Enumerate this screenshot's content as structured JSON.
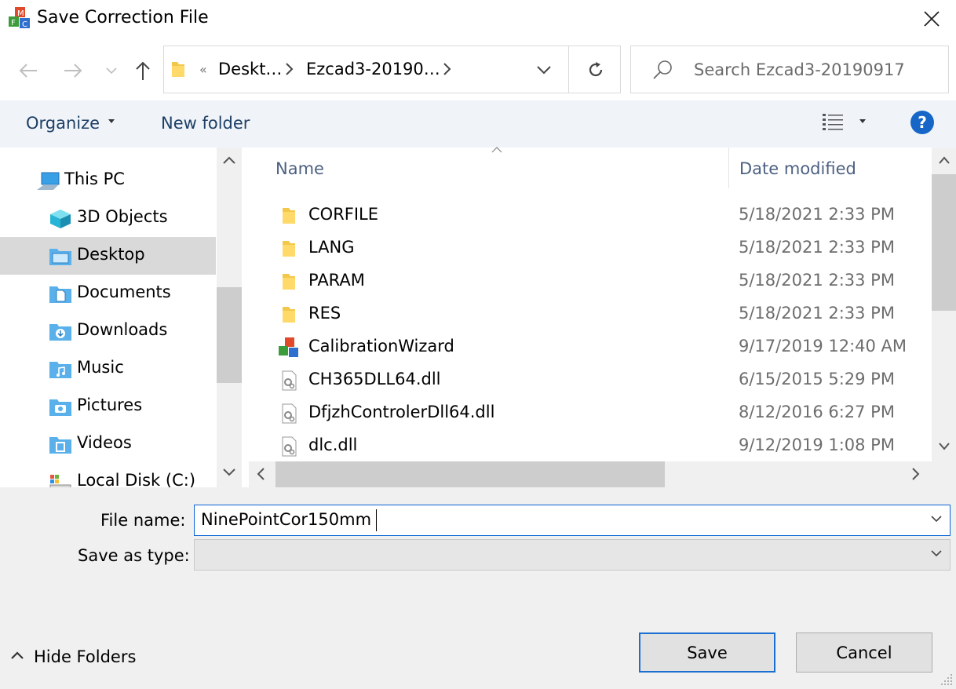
{
  "window": {
    "title": "Save Correction File",
    "app_icon": "mcc-cube-icon",
    "close_icon": "close-icon"
  },
  "nav": {
    "back_icon": "arrow-left-icon",
    "forward_icon": "arrow-right-icon",
    "recent_icon": "chevron-down-icon",
    "up_icon": "arrow-up-icon",
    "breadcrumb_overflow": "«",
    "breadcrumb": [
      "Deskt…",
      "Ezcad3-20190…"
    ],
    "refresh_icon": "refresh-icon",
    "search_placeholder": "Search Ezcad3-20190917"
  },
  "toolbar": {
    "organize": "Organize",
    "new_folder": "New folder",
    "help_icon": "help-icon"
  },
  "sidebar": {
    "items": [
      {
        "label": "This PC",
        "icon": "computer-icon"
      },
      {
        "label": "3D Objects",
        "icon": "cube-icon"
      },
      {
        "label": "Desktop",
        "icon": "desktop-folder-icon",
        "selected": true
      },
      {
        "label": "Documents",
        "icon": "documents-folder-icon"
      },
      {
        "label": "Downloads",
        "icon": "downloads-folder-icon"
      },
      {
        "label": "Music",
        "icon": "music-folder-icon"
      },
      {
        "label": "Pictures",
        "icon": "pictures-folder-icon"
      },
      {
        "label": "Videos",
        "icon": "videos-folder-icon"
      },
      {
        "label": "Local Disk (C:)",
        "icon": "drive-icon"
      }
    ]
  },
  "files": {
    "columns": {
      "name": "Name",
      "date": "Date modified"
    },
    "rows": [
      {
        "name": "CORFILE",
        "date": "5/18/2021 2:33 PM",
        "icon": "folder-icon"
      },
      {
        "name": "LANG",
        "date": "5/18/2021 2:33 PM",
        "icon": "folder-icon"
      },
      {
        "name": "PARAM",
        "date": "5/18/2021 2:33 PM",
        "icon": "folder-icon"
      },
      {
        "name": "RES",
        "date": "5/18/2021 2:33 PM",
        "icon": "folder-icon"
      },
      {
        "name": "CalibrationWizard",
        "date": "9/17/2019 12:40 AM",
        "icon": "app-icon"
      },
      {
        "name": "CH365DLL64.dll",
        "date": "6/15/2015 5:29 PM",
        "icon": "dll-icon"
      },
      {
        "name": "DfjzhControlerDll64.dll",
        "date": "8/12/2016 6:27 PM",
        "icon": "dll-icon"
      },
      {
        "name": "dlc.dll",
        "date": "9/12/2019 1:08 PM",
        "icon": "dll-icon"
      }
    ]
  },
  "form": {
    "file_name_label": "File name:",
    "file_name_value": "NinePointCor150mm",
    "save_type_label": "Save as type:",
    "save_type_value": ""
  },
  "footer": {
    "hide_folders": "Hide Folders",
    "save": "Save",
    "cancel": "Cancel"
  },
  "colors": {
    "accent": "#0a64d6",
    "toolbar_bg": "#f0f4f9",
    "link_text": "#1e3f66",
    "folder": "#f3c84a",
    "selected_bg": "#d9d9d9"
  }
}
